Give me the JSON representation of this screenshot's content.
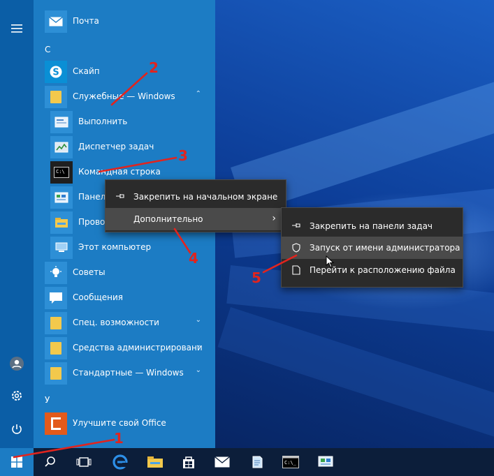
{
  "start_menu": {
    "top_items": [
      {
        "label": "Почта",
        "icon": "mail-icon"
      }
    ],
    "section_c": "С",
    "items_c": [
      {
        "label": "Скайп",
        "icon": "skype-icon"
      },
      {
        "label": "Служебные — Windows",
        "icon": "folder-icon",
        "expanded": true
      }
    ],
    "sub_items": [
      {
        "label": "Выполнить",
        "icon": "run-icon"
      },
      {
        "label": "Диспетчер задач",
        "icon": "task-manager-icon"
      },
      {
        "label": "Командная строка",
        "icon": "cmd-icon"
      },
      {
        "label": "Панел",
        "icon": "control-panel-icon"
      },
      {
        "label": "Провод",
        "icon": "explorer-icon"
      },
      {
        "label": "Этот компьютер",
        "icon": "computer-icon"
      }
    ],
    "items_after": [
      {
        "label": "Советы",
        "icon": "tips-icon"
      },
      {
        "label": "Сообщения",
        "icon": "messages-icon"
      },
      {
        "label": "Спец. возможности",
        "icon": "folder-icon"
      },
      {
        "label": "Средства администрировани",
        "icon": "folder-icon"
      },
      {
        "label": "Стандартные — Windows",
        "icon": "folder-icon"
      }
    ],
    "section_u": "У",
    "items_u": [
      {
        "label": "Улучшите свой Office",
        "icon": "office-icon"
      }
    ]
  },
  "context_menu_1": {
    "pin_start": "Закрепить на начальном экране",
    "more": "Дополнительно"
  },
  "context_menu_2": {
    "pin_taskbar": "Закрепить на панели задач",
    "run_as_admin": "Запуск от имени администратора",
    "open_location": "Перейти к расположению файла"
  },
  "annotations": [
    "1",
    "2",
    "3",
    "4",
    "5"
  ],
  "colors": {
    "menu_bg": "#1c7cc4",
    "rail_bg": "#0b5ea6",
    "annotation": "#e1241e",
    "context_bg": "#2b2b2b"
  }
}
